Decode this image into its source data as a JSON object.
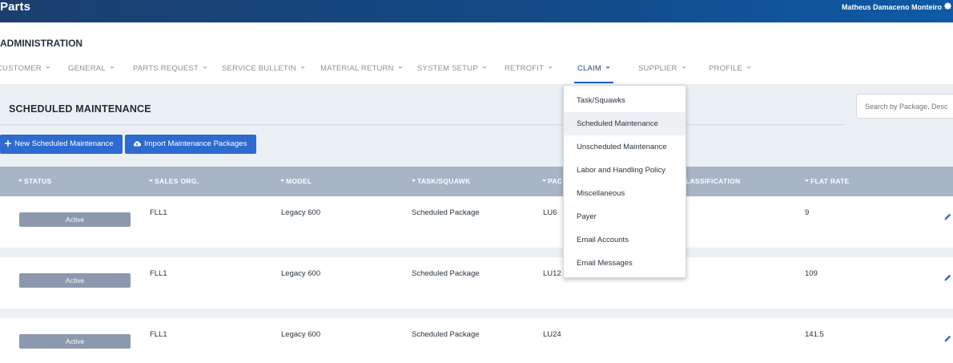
{
  "app": {
    "title": "Parts",
    "user_name": "Matheus Damaceno Monteiro"
  },
  "admin": {
    "heading": "ADMINISTRATION"
  },
  "nav": {
    "items": [
      {
        "label": "CUSTOMER"
      },
      {
        "label": "GENERAL"
      },
      {
        "label": "PARTS REQUEST"
      },
      {
        "label": "SERVICE BULLETIN"
      },
      {
        "label": "MATERIAL RETURN"
      },
      {
        "label": "SYSTEM SETUP"
      },
      {
        "label": "RETROFIT"
      },
      {
        "label": "CLAIM",
        "active": true
      },
      {
        "label": "SUPPLIER"
      },
      {
        "label": "PROFILE"
      }
    ]
  },
  "claim_menu": {
    "items": [
      {
        "label": "Task/Squawks"
      },
      {
        "label": "Scheduled Maintenance",
        "hovered": true
      },
      {
        "label": "Unscheduled Maintenance"
      },
      {
        "label": "Labor and Handling Policy"
      },
      {
        "label": "Miscellaneous"
      },
      {
        "label": "Payer"
      },
      {
        "label": "Email Accounts"
      },
      {
        "label": "Email Messages"
      }
    ]
  },
  "page": {
    "title": "SCHEDULED MAINTENANCE",
    "search_placeholder": "Search by Package, Desc",
    "new_button": "New Scheduled Maintenance",
    "import_button": "Import Maintenance Packages"
  },
  "table": {
    "columns": [
      "STATUS",
      "SALES ORG.",
      "MODEL",
      "TASK/SQUAWK",
      "PAC",
      "LASSIFICATION",
      "FLAT RATE"
    ],
    "rows": [
      {
        "status": "Active",
        "sales_org": "FLL1",
        "model": "Legacy 600",
        "task": "Scheduled Package",
        "package": "LU6",
        "flat_rate": "9"
      },
      {
        "status": "Active",
        "sales_org": "FLL1",
        "model": "Legacy 600",
        "task": "Scheduled Package",
        "package": "LU12",
        "flat_rate": "109"
      },
      {
        "status": "Active",
        "sales_org": "FLL1",
        "model": "Legacy 600",
        "task": "Scheduled Package",
        "package": "LU24",
        "flat_rate": "141.5"
      }
    ]
  },
  "colors": {
    "topbar": "#134a86",
    "accent": "#2e6bd1",
    "badge": "#8b98ad",
    "table_header": "#a7b5c6",
    "panel": "#eaf0f4"
  },
  "icons": {
    "settings": "gear-icon",
    "add": "plus-icon",
    "import": "cloud-upload-icon",
    "edit": "pencil-icon",
    "sort": "caret-down-icon",
    "menu": "chevron-down-icon"
  }
}
